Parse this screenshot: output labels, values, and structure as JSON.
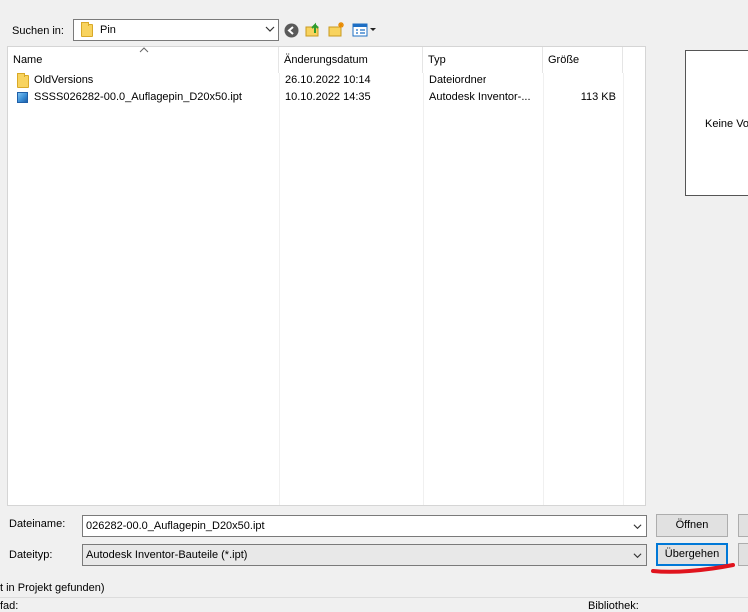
{
  "lookin": {
    "label": "Suchen in:",
    "value": "Pin"
  },
  "toolbar": {
    "back_icon": "back-icon",
    "up_icon": "up-folder-icon",
    "new_folder_icon": "new-folder-icon",
    "view_icon": "view-menu-icon"
  },
  "columns": {
    "name": "Name",
    "date": "Änderungsdatum",
    "type": "Typ",
    "size": "Größe"
  },
  "files": [
    {
      "name": "OldVersions",
      "date": "26.10.2022 10:14",
      "type": "Dateiordner",
      "size": "",
      "icon": "folder-icon"
    },
    {
      "name": "SSSS026282-00.0_Auflagepin_D20x50.ipt",
      "date": "10.10.2022 14:35",
      "type": "Autodesk Inventor-...",
      "size": "113 KB",
      "icon": "inventor-part-icon"
    }
  ],
  "preview": {
    "text": "Keine Vor"
  },
  "filename": {
    "label": "Dateiname:",
    "value": "026282-00.0_Auflagepin_D20x50.ipt"
  },
  "filetype": {
    "label": "Dateityp:",
    "value": "Autodesk Inventor-Bauteile (*.ipt)"
  },
  "buttons": {
    "open": "Öffnen",
    "skip": "Übergehen"
  },
  "status": {
    "project": "t in Projekt gefunden)",
    "path": "fad:",
    "library": "Bibliothek:"
  },
  "colors": {
    "annotation": "#e0141e",
    "accent": "#0078d7"
  }
}
